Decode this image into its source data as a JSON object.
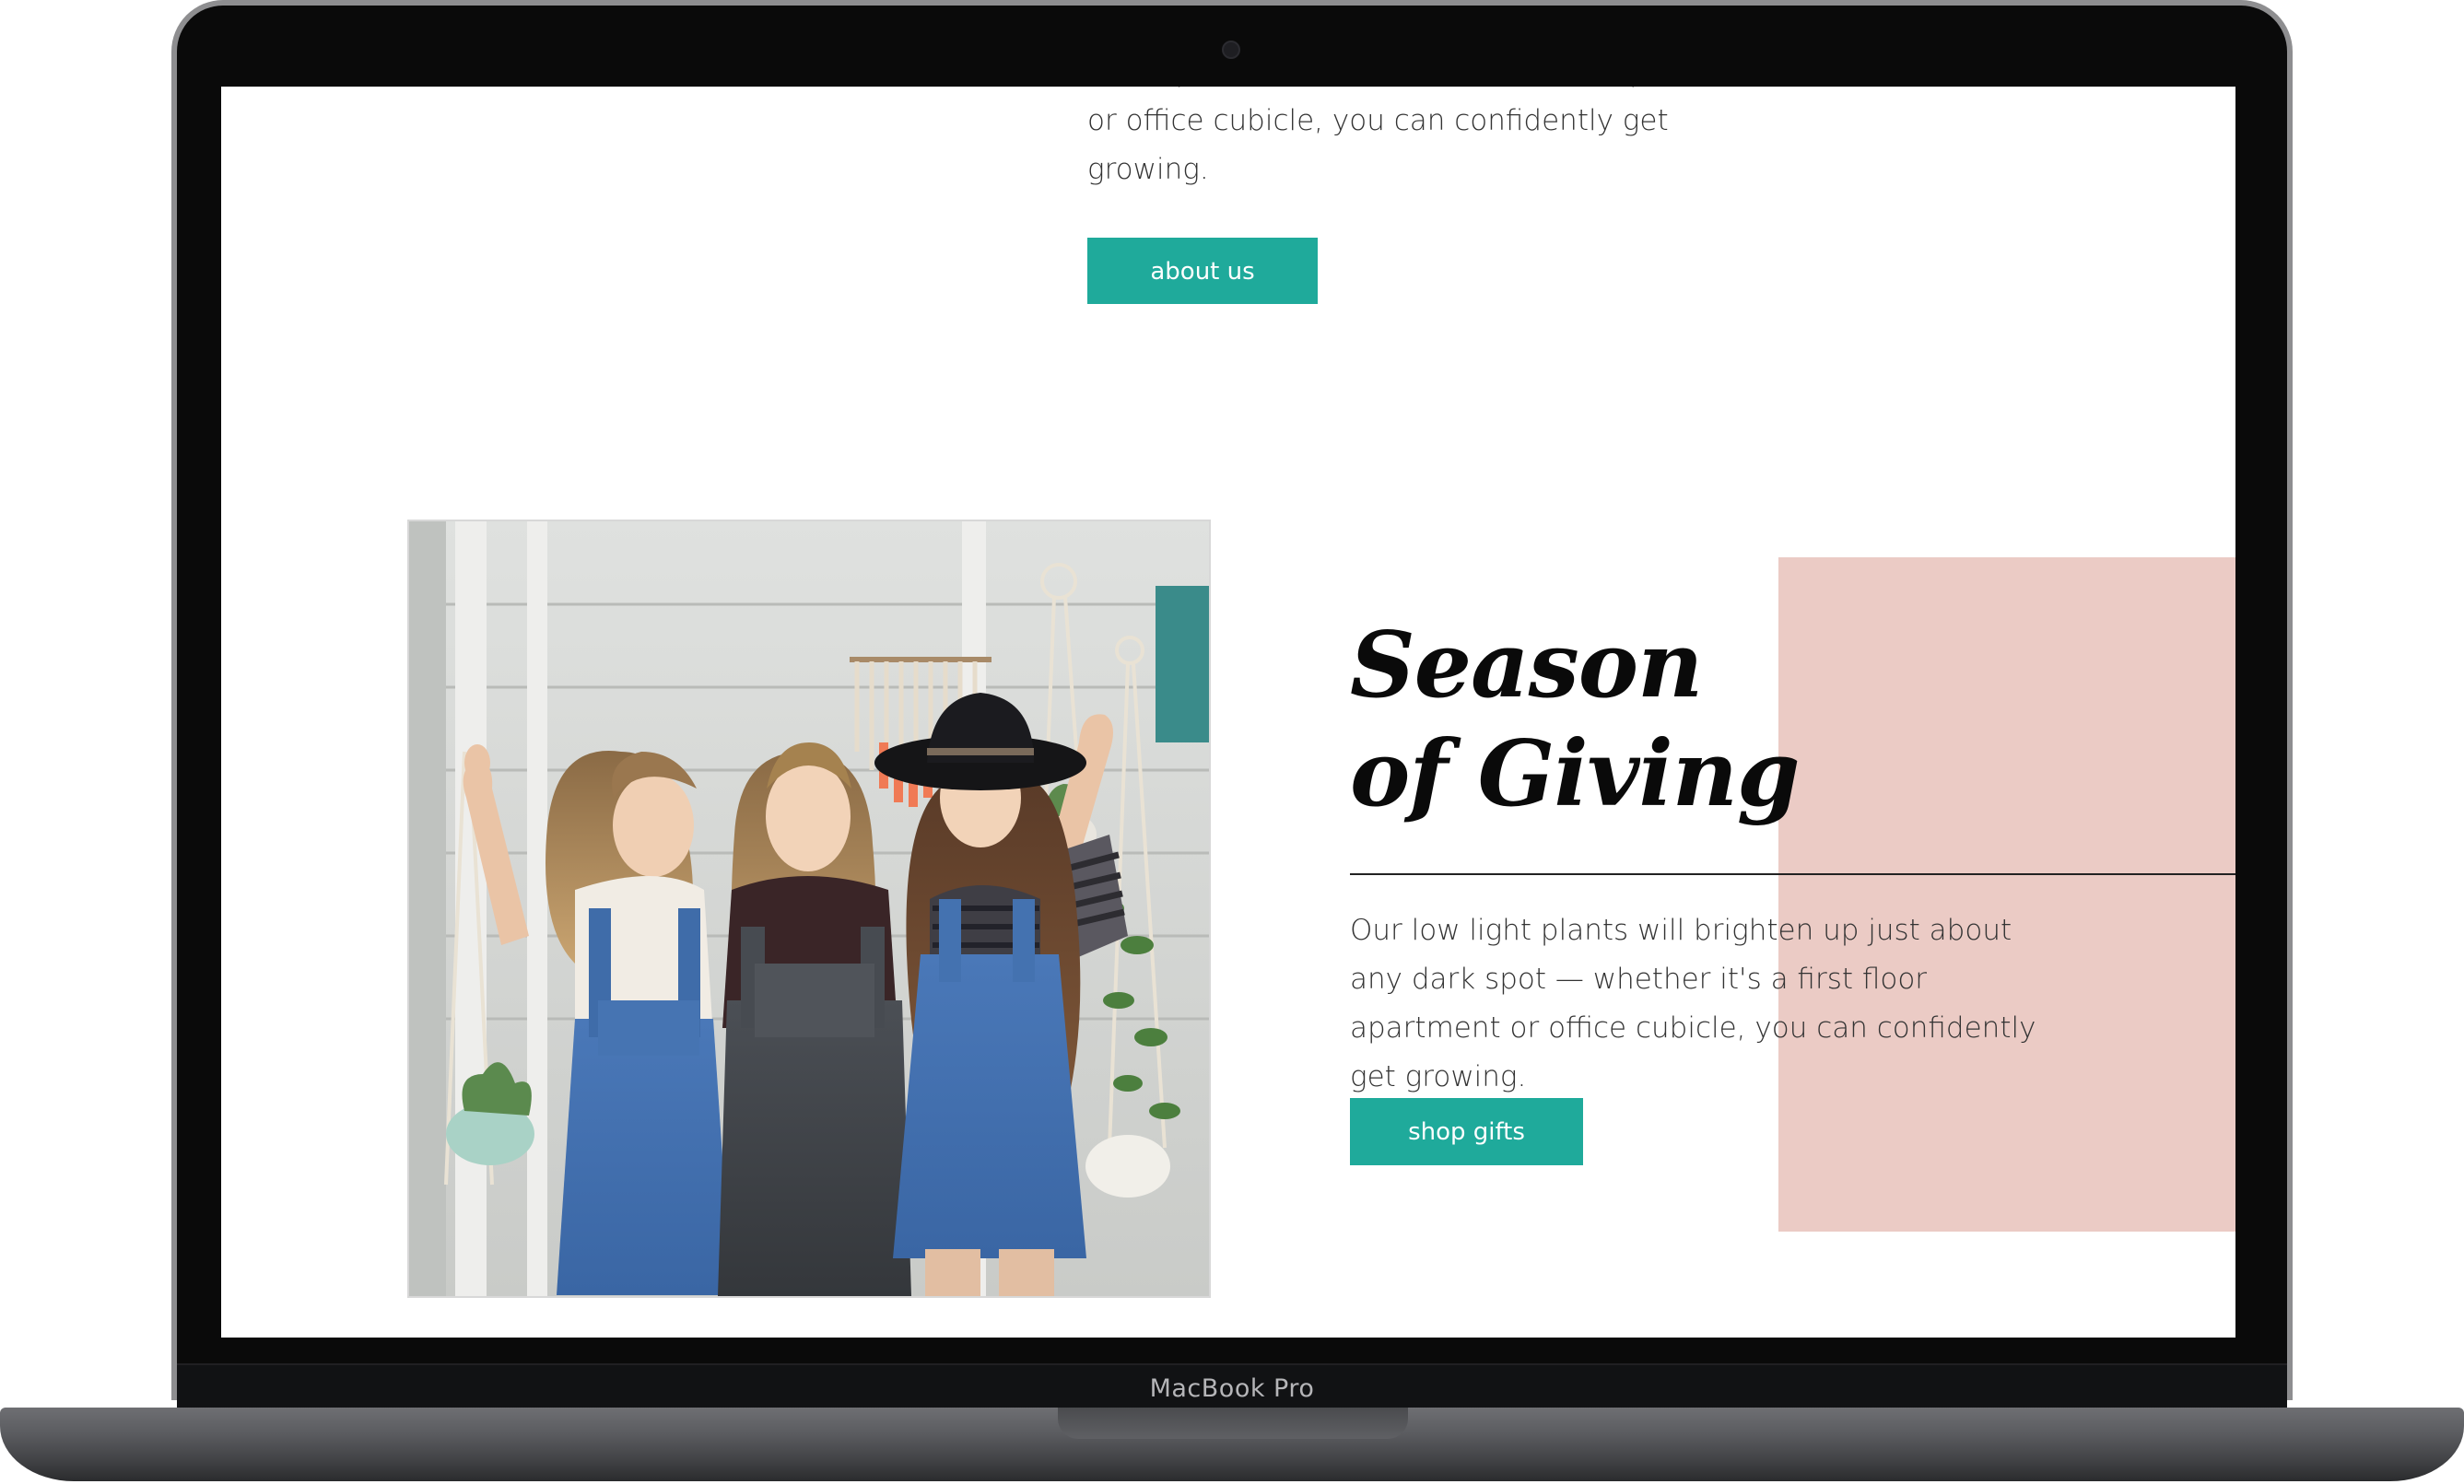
{
  "device": {
    "label": "MacBook Pro"
  },
  "intro": {
    "paragraph": "dark spot — whether it's a first floor apartment or office cubicle, you can confidently get growing.",
    "button_label": "about us"
  },
  "feature": {
    "heading_line1": "Season",
    "heading_line2": "of Giving",
    "paragraph": "Our low light plants will brighten up just about any dark spot — whether it's a first floor apartment or office cubicle, you can confidently get growing.",
    "button_label": "shop gifts"
  },
  "colors": {
    "accent": "#1faa9b",
    "pink_block": "#ebcbc5",
    "text": "#333333",
    "heading": "#0a0a0a"
  },
  "icons": {
    "photo": "photo-three-women-with-plant-hangers"
  }
}
